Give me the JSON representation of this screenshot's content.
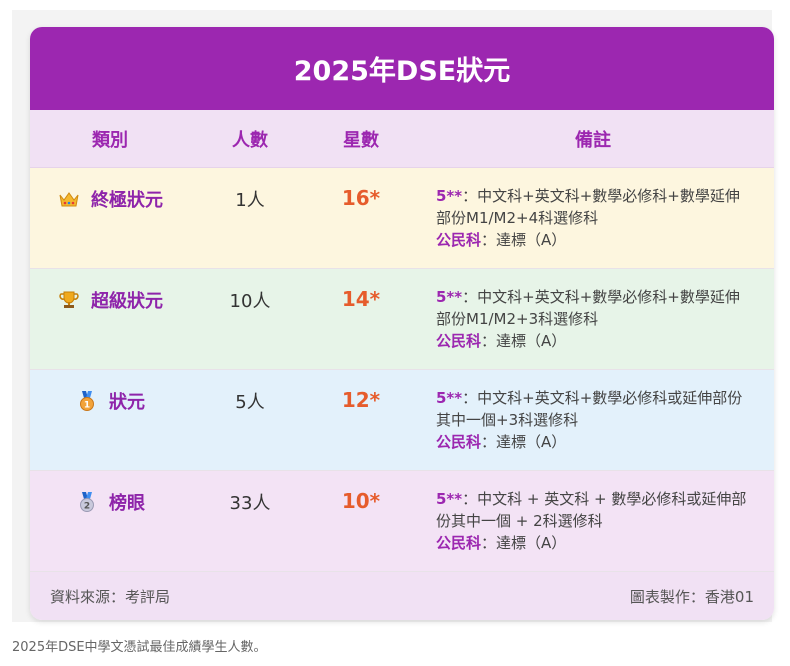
{
  "title": "2025年DSE狀元",
  "headers": {
    "category": "類別",
    "count": "人數",
    "stars": "星數",
    "remarks": "備註"
  },
  "rows": [
    {
      "category": "終極狀元",
      "icon": "crown-icon",
      "count": "1人",
      "stars": "16*",
      "bg": "#fdf6df",
      "note_key": "5**",
      "note_text": "：中文科+英文科+數學必修科+數學延伸部份M1/M2+4科選修科",
      "civics_key": "公民科",
      "civics_text": "：達標（A）"
    },
    {
      "category": "超級狀元",
      "icon": "trophy-icon",
      "count": "10人",
      "stars": "14*",
      "bg": "#e7f4e8",
      "note_key": "5**",
      "note_text": "：中文科+英文科+數學必修科+數學延伸部份M1/M2+3科選修科",
      "civics_key": "公民科",
      "civics_text": "：達標（A）"
    },
    {
      "category": "狀元",
      "icon": "medal-1st-icon",
      "count": "5人",
      "stars": "12*",
      "bg": "#e3f1fb",
      "note_key": "5**",
      "note_text": "：中文科+英文科+數學必修科或延伸部份其中一個+3科選修科",
      "civics_key": "公民科",
      "civics_text": "：達標（A）"
    },
    {
      "category": "榜眼",
      "icon": "medal-2nd-icon",
      "count": "33人",
      "stars": "10*",
      "bg": "#f3e3f5",
      "note_key": "5**",
      "note_text": "：中文科 + 英文科 + 數學必修科或延伸部份其中一個 + 2科選修科",
      "civics_key": "公民科",
      "civics_text": "：達標（A）"
    }
  ],
  "footer": {
    "source": "資料來源：考評局",
    "credit": "圖表製作：香港01"
  },
  "caption": "2025年DSE中學文憑試最佳成績學生人數。",
  "colors": {
    "header_bg": "#9c27b0",
    "accent": "#9c27b0",
    "stars": "#e65c2c"
  }
}
